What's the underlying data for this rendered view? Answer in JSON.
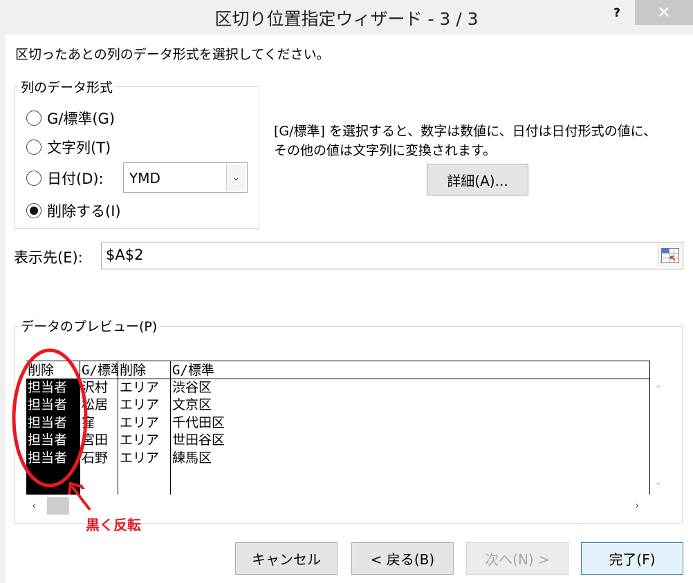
{
  "window": {
    "title": "区切り位置指定ウィザード - 3 / 3",
    "help": "?",
    "close": "✕"
  },
  "instruction": "区切ったあとの列のデータ形式を選択してください。",
  "column_format": {
    "group_title": "列のデータ形式",
    "options": [
      {
        "label": "G/標準(G)",
        "selected": false
      },
      {
        "label": "文字列(T)",
        "selected": false
      },
      {
        "label": "日付(D):",
        "selected": false
      },
      {
        "label": "削除する(I)",
        "selected": true
      }
    ],
    "date_format_value": "YMD"
  },
  "description": {
    "line1": "[G/標準] を選択すると、数字は数値に、日付は日付形式の値に、",
    "line2": "その他の値は文字列に変換されます。"
  },
  "detail_button": "詳細(A)...",
  "destination": {
    "label": "表示先(E):",
    "value": "$A$2",
    "icon": "range-select-icon"
  },
  "preview": {
    "group_title": "データのプレビュー(P)",
    "columns": [
      {
        "header": "削除",
        "cells": [
          "担当者",
          "担当者",
          "担当者",
          "担当者",
          "担当者"
        ]
      },
      {
        "header": "G/標準",
        "cells": [
          "沢村",
          "松居",
          "窪",
          "宮田",
          "石野"
        ]
      },
      {
        "header": "削除",
        "cells": [
          "エリア",
          "エリア",
          "エリア",
          "エリア",
          "エリア"
        ]
      },
      {
        "header": "G/標準",
        "cells": [
          "渋谷区",
          "文京区",
          "千代田区",
          "世田谷区",
          "練馬区"
        ]
      }
    ]
  },
  "annotation": {
    "label": "黒く反転",
    "color": "#e8191f"
  },
  "buttons": {
    "cancel": "キャンセル",
    "back": "< 戻る(B)",
    "next": "次へ(N) >",
    "finish": "完了(F)"
  }
}
